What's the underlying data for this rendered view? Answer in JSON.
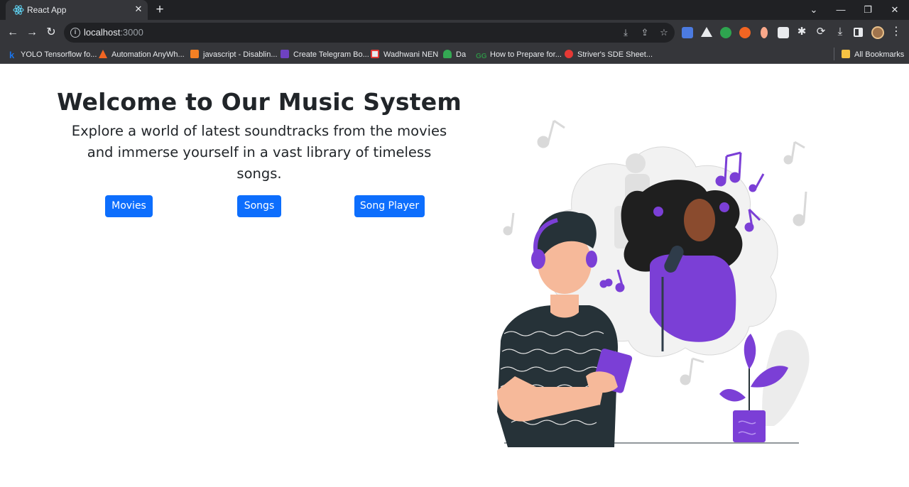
{
  "browser": {
    "tab_title": "React App",
    "url_host": "localhost",
    "url_port": ":3000",
    "bookmarks": [
      {
        "label": "YOLO Tensorflow fo...",
        "color": "#1a73e8"
      },
      {
        "label": "Automation AnyWh...",
        "color": "#f26522"
      },
      {
        "label": "javascript - Disablin...",
        "color": "#f48024"
      },
      {
        "label": "Create Telegram Bo...",
        "color": "#6f42c1"
      },
      {
        "label": "Wadhwani NEN",
        "color": "#e8eaed"
      },
      {
        "label": "Da",
        "color": "#34a853"
      },
      {
        "label": "How to Prepare for...",
        "color": "#2f8d46"
      },
      {
        "label": "Striver's SDE Sheet...",
        "color": "#e53935"
      }
    ],
    "all_bookmarks": "All Bookmarks"
  },
  "page": {
    "title": "Welcome to Our Music System",
    "subtitle": "Explore a world of latest soundtracks from the movies and immerse yourself in a vast library of timeless songs.",
    "buttons": {
      "movies": "Movies",
      "songs": "Songs",
      "player": "Song Player"
    }
  },
  "colors": {
    "primary": "#0d6efd",
    "illustration_accent": "#7b3fd6",
    "chrome_dark": "#202124",
    "chrome_toolbar": "#35363a"
  }
}
